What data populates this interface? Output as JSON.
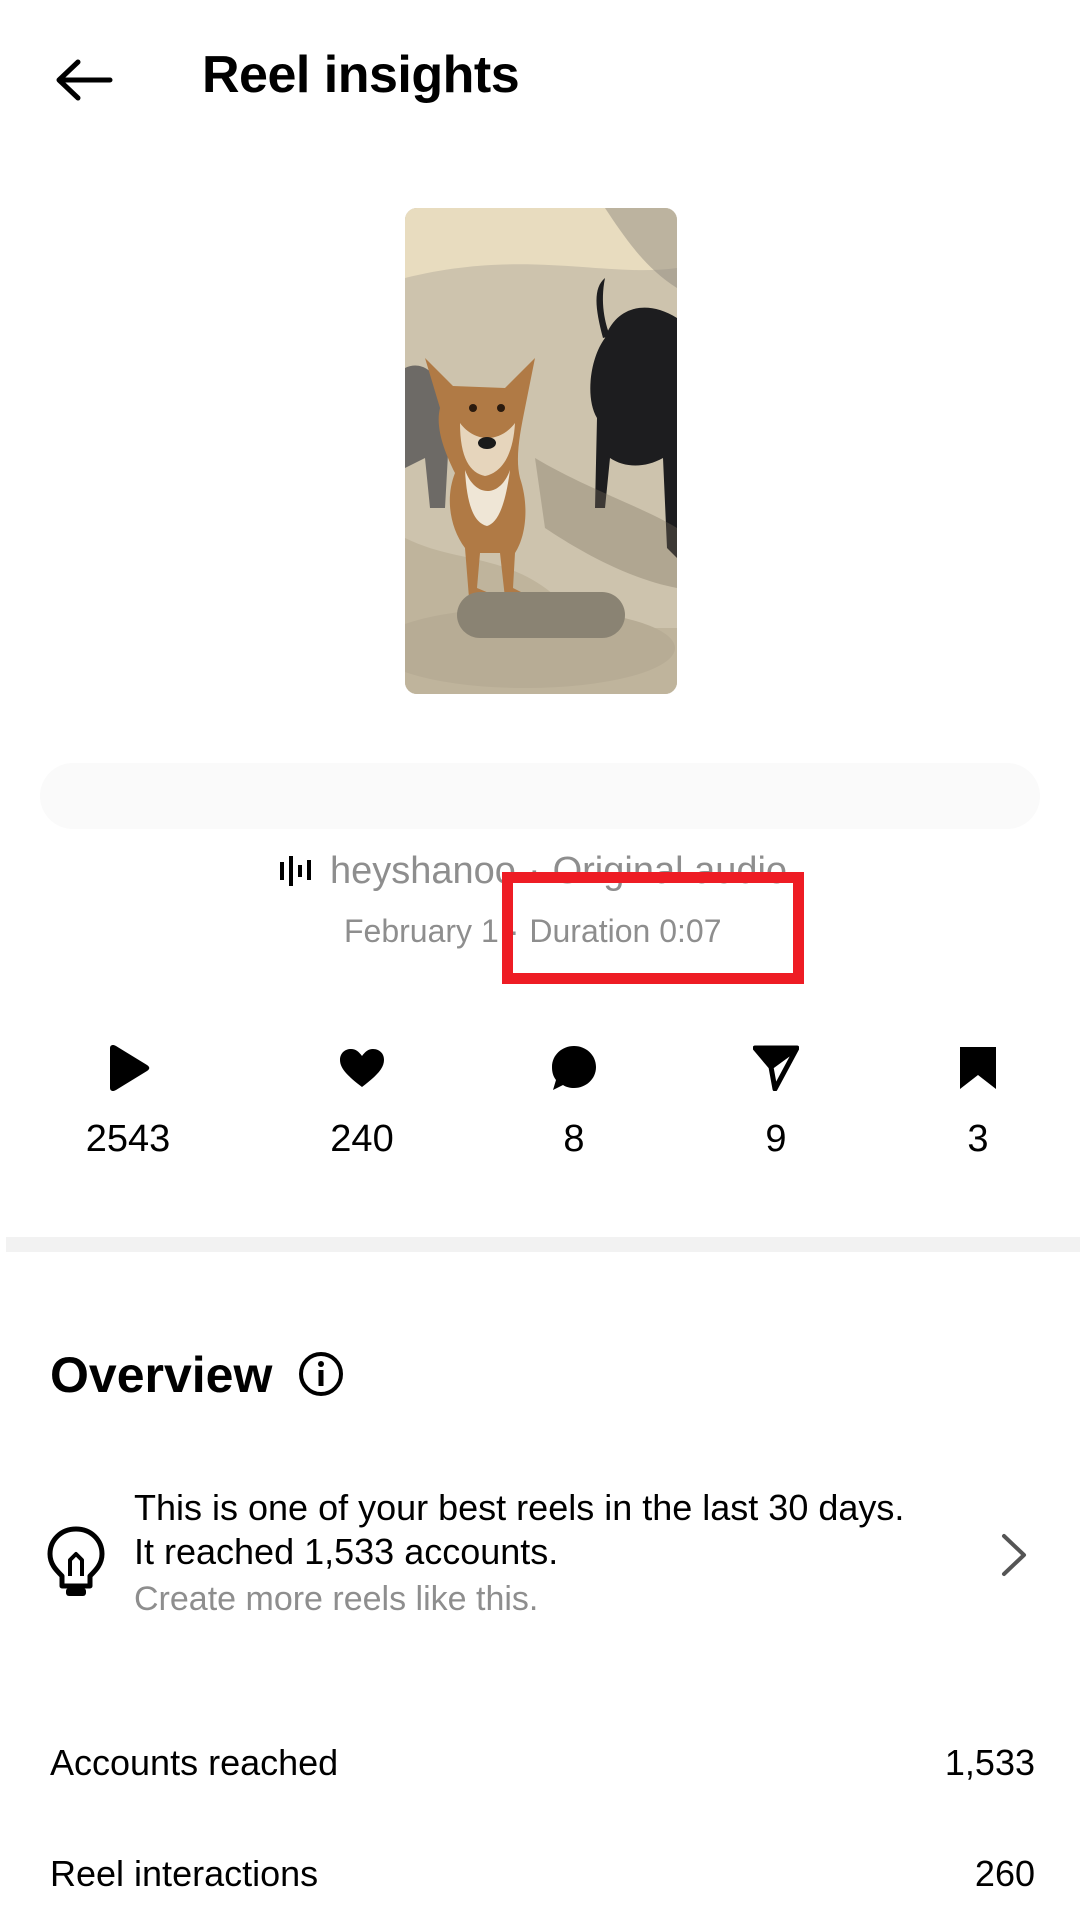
{
  "header": {
    "title": "Reel insights",
    "back_icon": "arrow-left-icon"
  },
  "reel": {
    "audio_icon": "audio-waveform-icon",
    "audio_user": "heyshanoo",
    "audio_separator": "·",
    "audio_name": "Original audio",
    "date": "February 1",
    "meta_separator": "·",
    "duration": "Duration 0:07"
  },
  "stats": [
    {
      "icon": "play-icon",
      "value": "2543"
    },
    {
      "icon": "heart-icon",
      "value": "240"
    },
    {
      "icon": "comment-icon",
      "value": "8"
    },
    {
      "icon": "send-icon",
      "value": "9"
    },
    {
      "icon": "bookmark-icon",
      "value": "3"
    }
  ],
  "overview": {
    "title": "Overview",
    "info_icon": "info-icon",
    "insight": {
      "icon": "lightbulb-icon",
      "line1": "This is one of your best reels in the last 30 days.",
      "line2": "It reached 1,533 accounts.",
      "cta": "Create more reels like this."
    },
    "metrics": [
      {
        "label": "Accounts reached",
        "value": "1,533"
      },
      {
        "label": "Reel interactions",
        "value": "260"
      }
    ]
  },
  "colors": {
    "highlight": "#ee1c24",
    "secondary_text": "#8e8e8e",
    "divider": "#f2f2f2"
  }
}
